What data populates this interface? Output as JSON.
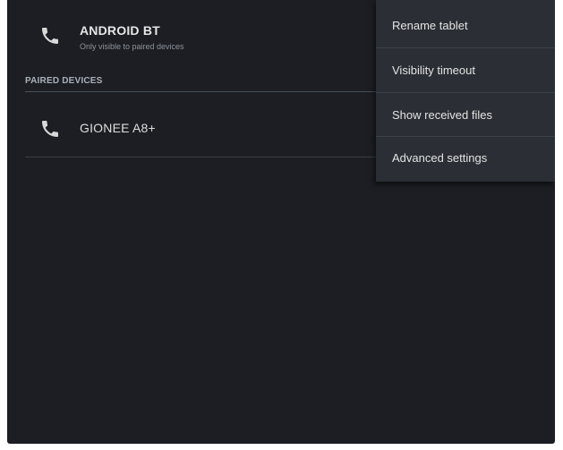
{
  "own_device": {
    "name": "ANDROID BT",
    "subtitle": "Only visible to paired devices",
    "icon": "phone-icon"
  },
  "paired_section": {
    "header": "PAIRED DEVICES",
    "devices": [
      {
        "name": "GIONEE A8+",
        "icon": "phone-icon"
      }
    ]
  },
  "overflow_menu": {
    "items": [
      {
        "label": "Rename tablet"
      },
      {
        "label": "Visibility timeout"
      },
      {
        "label": "Show received files"
      },
      {
        "label": "Advanced settings"
      }
    ]
  },
  "colors": {
    "background": "#1c1e24",
    "menu_background": "#2b2e35",
    "text_primary": "#e6e6e6",
    "text_secondary": "#8f939a"
  }
}
